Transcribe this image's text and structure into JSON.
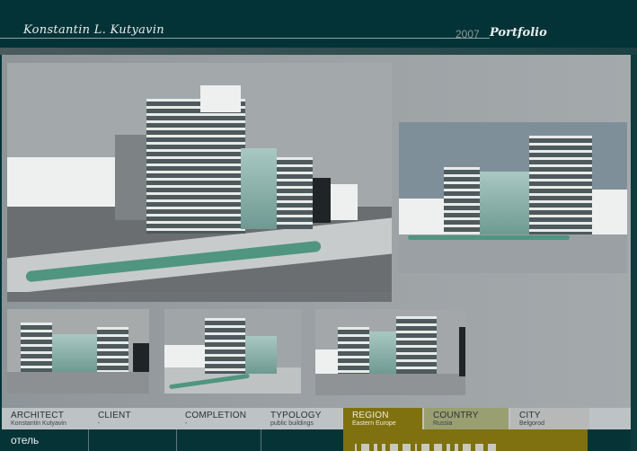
{
  "header": {
    "author": "Konstantin L. Kutyavin",
    "year": "2007",
    "title": "Portfolio"
  },
  "images": {
    "main": "hotel-render-street-view",
    "side": "hotel-render-side-view",
    "thumbnails": [
      "hotel-render-front",
      "hotel-render-corner",
      "hotel-render-perspective"
    ]
  },
  "info": {
    "architect": {
      "label": "ARCHITECT",
      "value": "Konstantin Kutyavin"
    },
    "client": {
      "label": "CLIENT",
      "value": "-"
    },
    "completion": {
      "label": "COMPLETION",
      "value": "-"
    },
    "typology": {
      "label": "TYPOLOGY",
      "value": "public buildings"
    },
    "region": {
      "label": "REGION",
      "value": "Eastern Europe"
    },
    "country": {
      "label": "COUNTRY",
      "value": "Russia"
    },
    "city": {
      "label": "CITY",
      "value": "Belgorod"
    }
  },
  "footer": {
    "project_name": "отель"
  },
  "colors": {
    "header_bg": "#033336",
    "region_bg": "#7f710f",
    "country_bg": "#9a9f72",
    "city_bg": "#b7b9b9",
    "info_bg": "#bdc3c5"
  }
}
